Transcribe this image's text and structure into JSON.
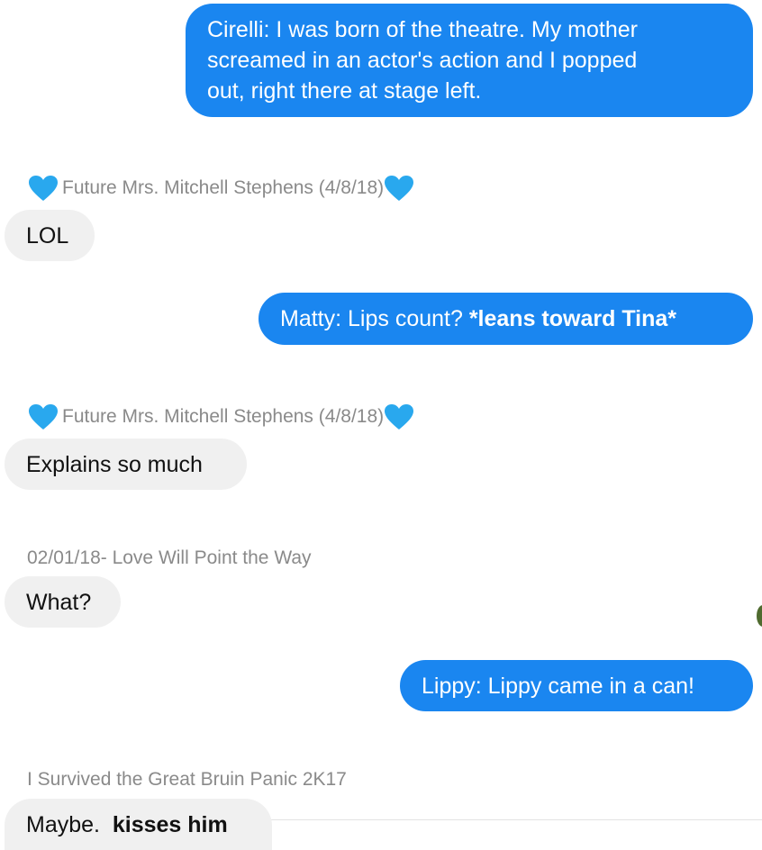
{
  "messages": [
    {
      "type": "outgoing",
      "lines": [
        "Cirelli: I was born of the theatre. My mother",
        "screamed in an actor's action and I popped",
        "out, right there at stage left."
      ]
    },
    {
      "type": "incoming",
      "sender": "Future Mrs. Mitchell Stephens (4/8/18)",
      "sender_icons": [
        "blue-heart-icon",
        "blue-heart-icon"
      ],
      "text": "LOL"
    },
    {
      "type": "outgoing",
      "text_plain": "Matty: Lips count? ",
      "text_bold": "*leans toward Tina*"
    },
    {
      "type": "incoming",
      "sender": "Future Mrs. Mitchell Stephens (4/8/18)",
      "sender_icons": [
        "blue-heart-icon",
        "blue-heart-icon"
      ],
      "text": "Explains so much"
    },
    {
      "type": "incoming",
      "sender": "02/01/18- Love Will Point the Way",
      "text": "What?"
    },
    {
      "type": "outgoing",
      "text": "Lippy: Lippy came in a can!"
    },
    {
      "type": "incoming",
      "sender": "I Survived the Great Bruin Panic 2K17",
      "text_plain": "Maybe.  ",
      "text_bold": "kisses him"
    }
  ],
  "colors": {
    "outgoing_bubble": "#1a86f0",
    "incoming_bubble": "#f0f0f0",
    "sender_text": "#8a8a8a",
    "heart": "#29a8ee"
  }
}
